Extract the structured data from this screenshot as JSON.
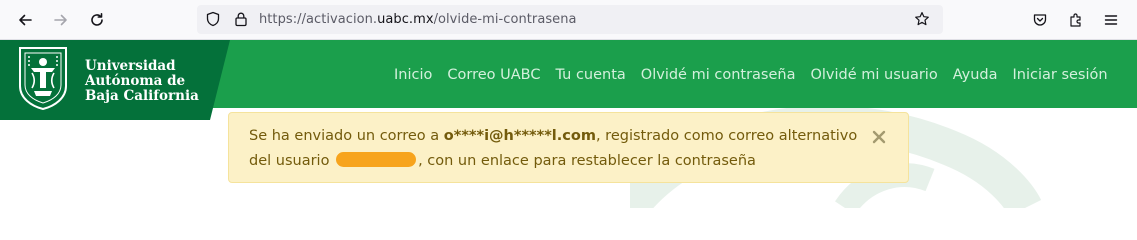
{
  "browser": {
    "url_prefix": "https://activacion.",
    "url_host": "uabc.mx",
    "url_path": "/olvide-mi-contrasena",
    "icons": [
      "back-arrow-icon",
      "forward-arrow-icon",
      "reload-icon",
      "shield-icon",
      "lock-icon",
      "star-icon",
      "pocket-icon",
      "extensions-icon",
      "menu-icon"
    ]
  },
  "brand": {
    "line1": "Universidad",
    "line2": "Autónoma de",
    "line3": "Baja California",
    "colors": {
      "dark_green": "#04713a",
      "green": "#1b9f4c"
    }
  },
  "nav": {
    "items": [
      "Inicio",
      "Correo UABC",
      "Tu cuenta",
      "Olvidé mi contraseña",
      "Olvidé mi usuario",
      "Ayuda",
      "Iniciar sesión"
    ]
  },
  "alert": {
    "text_before": "Se ha enviado un correo a ",
    "email_masked": "o****i@h*****l.com",
    "text_after": ", registrado como correo alternativo",
    "line2_before": "del usuario ",
    "line2_after": ", con un enlace para restablecer la contraseña",
    "close_symbol": "×",
    "colors": {
      "background": "#fcf1c7",
      "text": "#735b0c",
      "redaction": "#f7a41d"
    }
  }
}
